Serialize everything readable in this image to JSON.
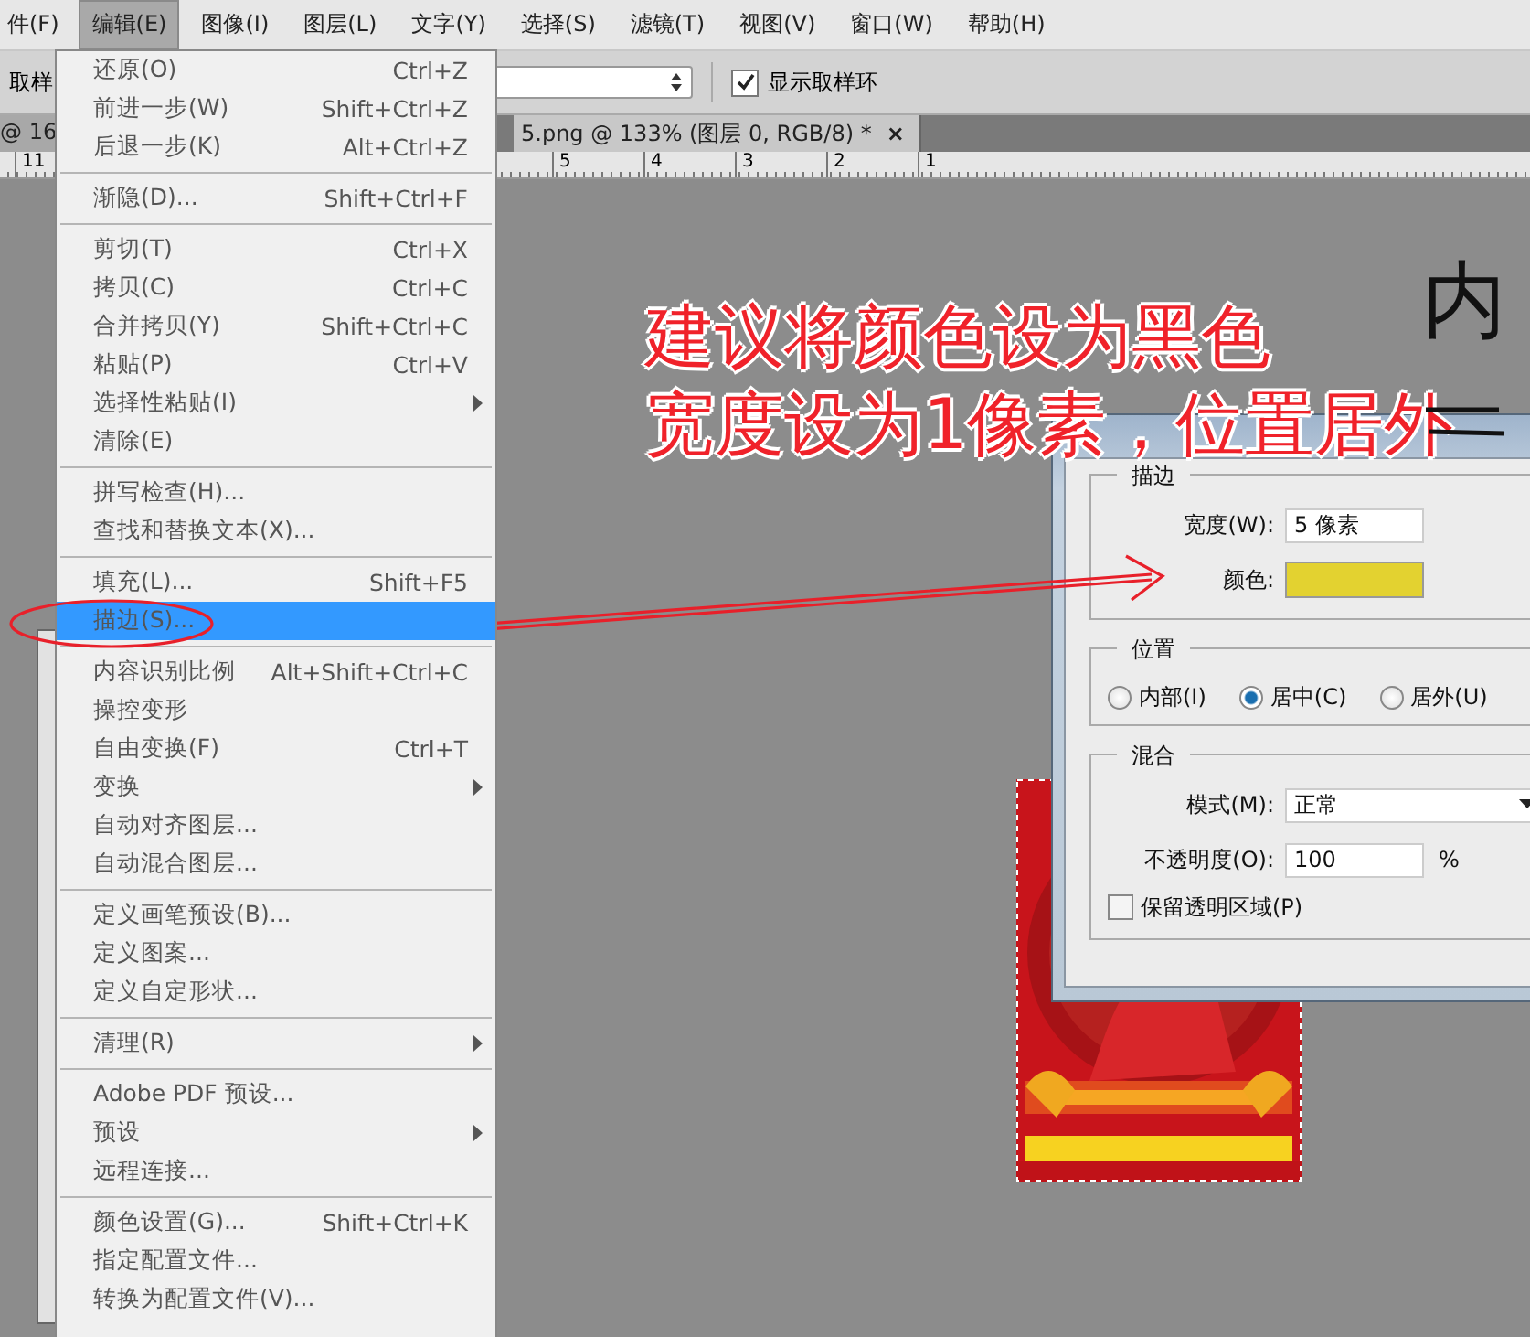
{
  "menu_bar": [
    {
      "label": "件(F)",
      "selected": false
    },
    {
      "label": "编辑(E)",
      "selected": true
    },
    {
      "label": "图像(I)",
      "selected": false
    },
    {
      "label": "图层(L)",
      "selected": false
    },
    {
      "label": "文字(Y)",
      "selected": false
    },
    {
      "label": "选择(S)",
      "selected": false
    },
    {
      "label": "滤镜(T)",
      "selected": false
    },
    {
      "label": "视图(V)",
      "selected": false
    },
    {
      "label": "窗口(W)",
      "selected": false
    },
    {
      "label": "帮助(H)",
      "selected": false
    }
  ],
  "options_bar": {
    "tool_label": "取样",
    "sample_ring": {
      "label": "显示取样环",
      "checked": true
    }
  },
  "document_tabs": [
    {
      "label": "@ 16",
      "selected": false
    },
    {
      "label": "5.png @ 133% (图层 0, RGB/8) *",
      "selected": true,
      "close": "×"
    }
  ],
  "ruler": [
    "11",
    "5",
    "4",
    "3",
    "2",
    "1"
  ],
  "edit_menu": {
    "groups": [
      [
        {
          "label": "还原(O)",
          "shortcut": "Ctrl+Z",
          "submenu": false,
          "highlighted": false
        },
        {
          "label": "前进一步(W)",
          "shortcut": "Shift+Ctrl+Z",
          "submenu": false,
          "highlighted": false
        },
        {
          "label": "后退一步(K)",
          "shortcut": "Alt+Ctrl+Z",
          "submenu": false,
          "highlighted": false
        }
      ],
      [
        {
          "label": "渐隐(D)...",
          "shortcut": "Shift+Ctrl+F",
          "submenu": false,
          "highlighted": false
        }
      ],
      [
        {
          "label": "剪切(T)",
          "shortcut": "Ctrl+X",
          "submenu": false,
          "highlighted": false
        },
        {
          "label": "拷贝(C)",
          "shortcut": "Ctrl+C",
          "submenu": false,
          "highlighted": false
        },
        {
          "label": "合并拷贝(Y)",
          "shortcut": "Shift+Ctrl+C",
          "submenu": false,
          "highlighted": false
        },
        {
          "label": "粘贴(P)",
          "shortcut": "Ctrl+V",
          "submenu": false,
          "highlighted": false
        },
        {
          "label": "选择性粘贴(I)",
          "submenu": true,
          "highlighted": false
        },
        {
          "label": "清除(E)",
          "submenu": false,
          "highlighted": false
        }
      ],
      [
        {
          "label": "拼写检查(H)...",
          "submenu": false,
          "highlighted": false
        },
        {
          "label": "查找和替换文本(X)...",
          "submenu": false,
          "highlighted": false
        }
      ],
      [
        {
          "label": "填充(L)...",
          "shortcut": "Shift+F5",
          "submenu": false,
          "highlighted": false
        },
        {
          "label": "描边(S)...",
          "submenu": false,
          "highlighted": true
        }
      ],
      [
        {
          "label": "内容识别比例",
          "shortcut": "Alt+Shift+Ctrl+C",
          "submenu": false,
          "highlighted": false
        },
        {
          "label": "操控变形",
          "submenu": false,
          "highlighted": false
        },
        {
          "label": "自由变换(F)",
          "shortcut": "Ctrl+T",
          "submenu": false,
          "highlighted": false
        },
        {
          "label": "变换",
          "submenu": true,
          "highlighted": false
        },
        {
          "label": "自动对齐图层...",
          "submenu": false,
          "highlighted": false
        },
        {
          "label": "自动混合图层...",
          "submenu": false,
          "highlighted": false
        }
      ],
      [
        {
          "label": "定义画笔预设(B)...",
          "submenu": false,
          "highlighted": false
        },
        {
          "label": "定义图案...",
          "submenu": false,
          "highlighted": false
        },
        {
          "label": "定义自定形状...",
          "submenu": false,
          "highlighted": false
        }
      ],
      [
        {
          "label": "清理(R)",
          "submenu": true,
          "highlighted": false
        }
      ],
      [
        {
          "label": "Adobe PDF 预设...",
          "submenu": false,
          "highlighted": false
        },
        {
          "label": "预设",
          "submenu": true,
          "highlighted": false
        },
        {
          "label": "远程连接...",
          "submenu": false,
          "highlighted": false
        }
      ],
      [
        {
          "label": "颜色设置(G)...",
          "shortcut": "Shift+Ctrl+K",
          "submenu": false,
          "highlighted": false
        },
        {
          "label": "指定配置文件...",
          "submenu": false,
          "highlighted": false
        },
        {
          "label": "转换为配置文件(V)...",
          "submenu": false,
          "highlighted": false
        }
      ]
    ]
  },
  "stroke_dialog": {
    "stroke": {
      "title": "描边",
      "width_label": "宽度(W):",
      "width_value": "5 像素",
      "color_label": "颜色:",
      "color": "#e3d230"
    },
    "location": {
      "title": "位置",
      "options": [
        {
          "label": "内部(I)",
          "selected": false
        },
        {
          "label": "居中(C)",
          "selected": true
        },
        {
          "label": "居外(U)",
          "selected": false
        }
      ]
    },
    "blending": {
      "title": "混合",
      "mode_label": "模式(M):",
      "mode_value": "正常",
      "opacity_label": "不透明度(O):",
      "opacity_value": "100",
      "opacity_unit": "%",
      "preserve": {
        "label": "保留透明区域(P)",
        "checked": false
      }
    }
  },
  "annotation": {
    "lines": [
      "建议将颜色设为黑色",
      "宽度设为1像素，位置居外"
    ],
    "correction": "内"
  }
}
